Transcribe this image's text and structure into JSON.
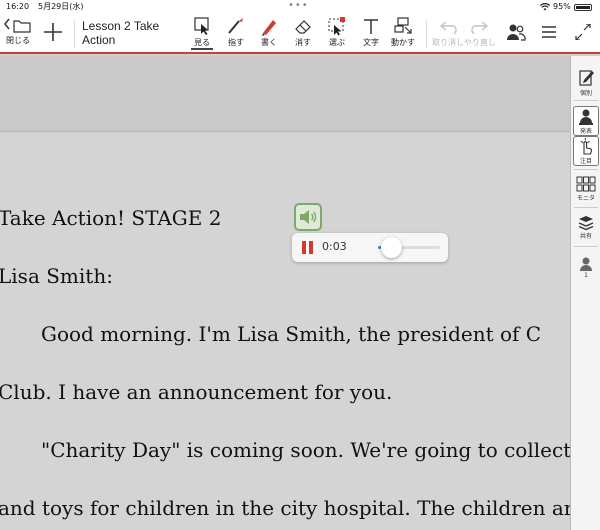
{
  "status": {
    "time": "16:20",
    "date": "5月29日(水)",
    "battery": "95%"
  },
  "toolbar": {
    "close_label": "閉じる",
    "title": [
      "Lesson 2 Take",
      "Action"
    ],
    "tools": [
      {
        "id": "view",
        "label": "見る"
      },
      {
        "id": "point",
        "label": "指す"
      },
      {
        "id": "write",
        "label": "書く"
      },
      {
        "id": "erase",
        "label": "消す"
      },
      {
        "id": "select",
        "label": "選ぶ"
      },
      {
        "id": "text",
        "label": "文字"
      },
      {
        "id": "move",
        "label": "動かす"
      },
      {
        "id": "undo_redo",
        "label": "取り消しやり直し"
      }
    ]
  },
  "document": {
    "lines": [
      "Take Action!    STAGE 2",
      "Lisa Smith:",
      "Good morning.    I'm Lisa Smith, the president of C",
      "Club.    I have an announcement for you.",
      "\"Charity Day\" is coming soon.    We're going to collect",
      "and toys for children in the city hospital.    The children are"
    ]
  },
  "audio": {
    "elapsed": "0:03",
    "progress": 0.05,
    "accent": "#d43a2c"
  },
  "sidebar": {
    "items": [
      {
        "id": "individual",
        "label": "個別"
      },
      {
        "id": "present",
        "label": "発表"
      },
      {
        "id": "attention",
        "label": "注目"
      },
      {
        "id": "monitor",
        "label": "モニタ"
      },
      {
        "id": "share",
        "label": "共有"
      },
      {
        "id": "users",
        "label": "1"
      }
    ]
  }
}
